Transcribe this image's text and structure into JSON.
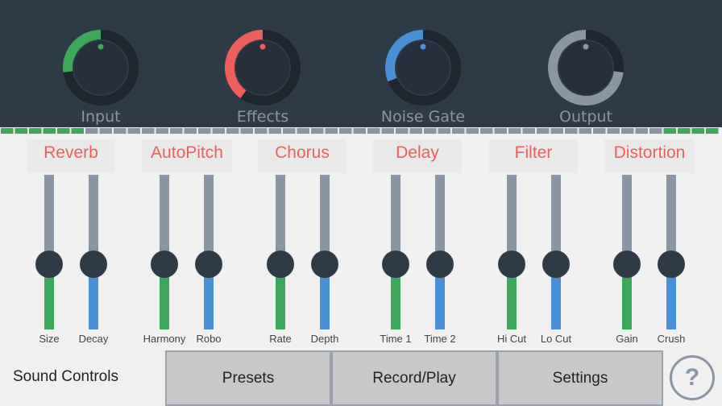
{
  "knobs": [
    {
      "label": "Input",
      "level": 0.27,
      "color": "#3ca95a"
    },
    {
      "label": "Effects",
      "level": 0.4,
      "color": "#ef5f5a"
    },
    {
      "label": "Noise Gate",
      "level": 0.31,
      "color": "#4a90d9"
    },
    {
      "label": "Output",
      "level": 0.73,
      "color": "#8a96a3"
    }
  ],
  "colors": {
    "accent": "#ef5f5a",
    "green": "#3ca95a",
    "blue": "#4a90d9",
    "track": "#8a96a3",
    "panel": "#2f3a47"
  },
  "effects": [
    {
      "title": "Reverb",
      "sliders": [
        {
          "label": "Size",
          "level": 0.42,
          "color": "#3ca95a"
        },
        {
          "label": "Decay",
          "level": 0.42,
          "color": "#4a90d9"
        }
      ]
    },
    {
      "title": "AutoPitch",
      "sliders": [
        {
          "label": "Harmony",
          "level": 0.42,
          "color": "#3ca95a"
        },
        {
          "label": "Robo",
          "level": 0.42,
          "color": "#4a90d9"
        }
      ]
    },
    {
      "title": "Chorus",
      "sliders": [
        {
          "label": "Rate",
          "level": 0.42,
          "color": "#3ca95a"
        },
        {
          "label": "Depth",
          "level": 0.42,
          "color": "#4a90d9"
        }
      ]
    },
    {
      "title": "Delay",
      "sliders": [
        {
          "label": "Time 1",
          "level": 0.42,
          "color": "#3ca95a"
        },
        {
          "label": "Time 2",
          "level": 0.42,
          "color": "#4a90d9"
        }
      ]
    },
    {
      "title": "Filter",
      "sliders": [
        {
          "label": "Hi Cut",
          "level": 0.42,
          "color": "#3ca95a"
        },
        {
          "label": "Lo Cut",
          "level": 0.42,
          "color": "#4a90d9"
        }
      ]
    },
    {
      "title": "Distortion",
      "sliders": [
        {
          "label": "Gain",
          "level": 0.42,
          "color": "#3ca95a"
        },
        {
          "label": "Crush",
          "level": 0.42,
          "color": "#4a90d9"
        }
      ]
    }
  ],
  "meter": {
    "left_level": 0.12,
    "right_level": 0.08
  },
  "bottom": {
    "app_label": "Sound Controls",
    "buttons": [
      "Presets",
      "Record/Play",
      "Settings"
    ],
    "help": "?"
  }
}
